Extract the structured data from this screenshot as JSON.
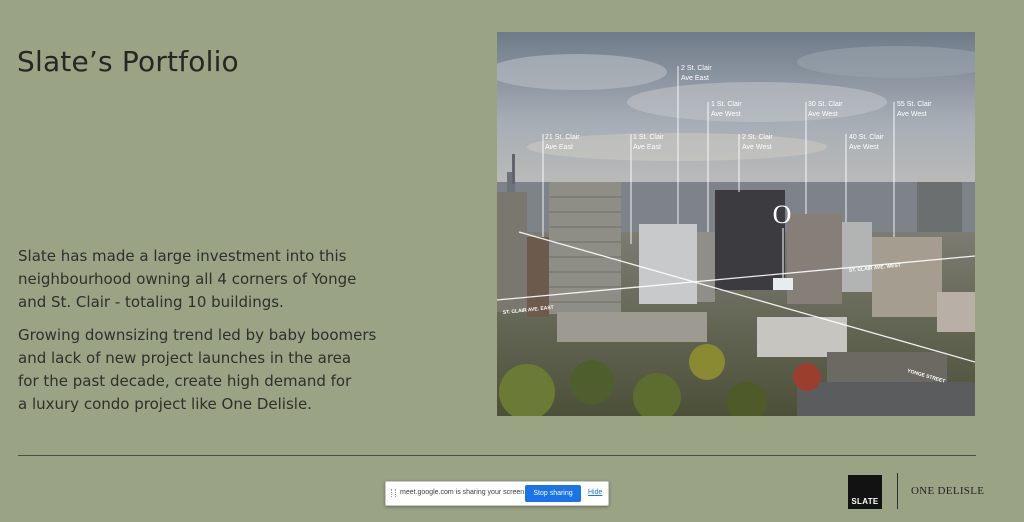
{
  "slide": {
    "title": "Slate’s Portfolio",
    "paragraph_1_lines": [
      "Slate has made a large investment into this",
      "neighbourhood owning all 4 corners of Yonge",
      "and St. Clair - totaling 10 buildings."
    ],
    "paragraph_2_lines": [
      "Growing downsizing trend led by baby boomers",
      "and lack of new project launches in the area",
      "for the past decade, create high demand for",
      "a luxury condo project like One Delisle."
    ]
  },
  "photo": {
    "building_labels": [
      {
        "line1": "21 St. Clair",
        "line2": "Ave East"
      },
      {
        "line1": "1 St. Clair",
        "line2": "Ave East"
      },
      {
        "line1": "2 St. Clair",
        "line2": "Ave East"
      },
      {
        "line1": "1 St. Clair",
        "line2": "Ave West"
      },
      {
        "line1": "2 St. Clair",
        "line2": "Ave West"
      },
      {
        "line1": "30 St. Clair",
        "line2": "Ave West"
      },
      {
        "line1": "40 St. Clair",
        "line2": "Ave West"
      },
      {
        "line1": "55 St. Clair",
        "line2": "Ave West"
      }
    ],
    "street_labels": {
      "st_clair_east": "ST. CLAIR AVE. EAST",
      "st_clair_west": "ST. CLAIR AVE. WEST",
      "yonge": "YONGE STREET"
    },
    "marker_glyph": "O"
  },
  "footer": {
    "logo_text": "SLATE",
    "brand_name": "ONE DELISLE"
  },
  "share_bar": {
    "message": "meet.google.com is sharing your screen.",
    "stop_label": "Stop sharing",
    "hide_label": "Hide"
  },
  "colors": {
    "background": "#9aa384",
    "accent_button": "#1a73e8"
  }
}
